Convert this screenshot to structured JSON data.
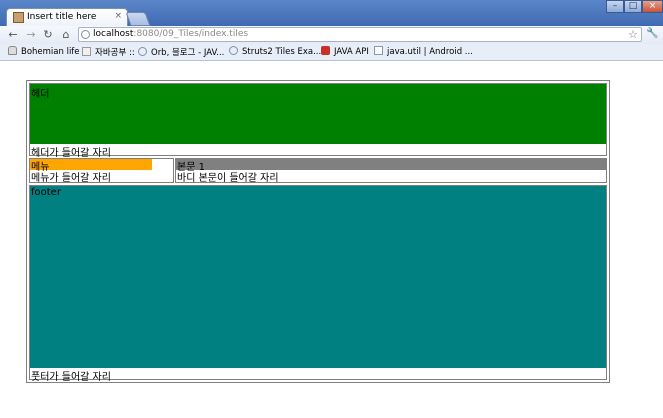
{
  "browser": {
    "tab_title": "Insert title here",
    "tab_close": "×",
    "url_host": "localhost",
    "url_path": ":8080/09_Tiles/index.tiles",
    "window_controls": {
      "minimize": "–",
      "maximize": "□",
      "close": "×"
    }
  },
  "bookmarks": [
    {
      "label": "Bohemian life ::",
      "icon": "bell-icon"
    },
    {
      "label": "자바공부 ::",
      "icon": "pen-icon"
    },
    {
      "label": "Orb, 블로그 - JAV...",
      "icon": "globe-icon"
    },
    {
      "label": "Struts2 Tiles Exa...",
      "icon": "globe-icon"
    },
    {
      "label": "JAVA API",
      "icon": "java-icon"
    },
    {
      "label": "java.util | Android ...",
      "icon": "page-icon"
    }
  ],
  "layout": {
    "header": {
      "title": "헤더",
      "caption": "헤더가 들어갈 자리",
      "color": "#008000"
    },
    "menu": {
      "title": "메뉴",
      "caption": "메뉴가 들어갈 자리",
      "color": "#FFA500"
    },
    "body": {
      "title": "본문 1",
      "caption": "바디 본문이 들어갈 자리",
      "color": "#808080"
    },
    "footer": {
      "title": "footer",
      "caption": "풋터가 들어갈 자리",
      "color": "#008080"
    }
  }
}
